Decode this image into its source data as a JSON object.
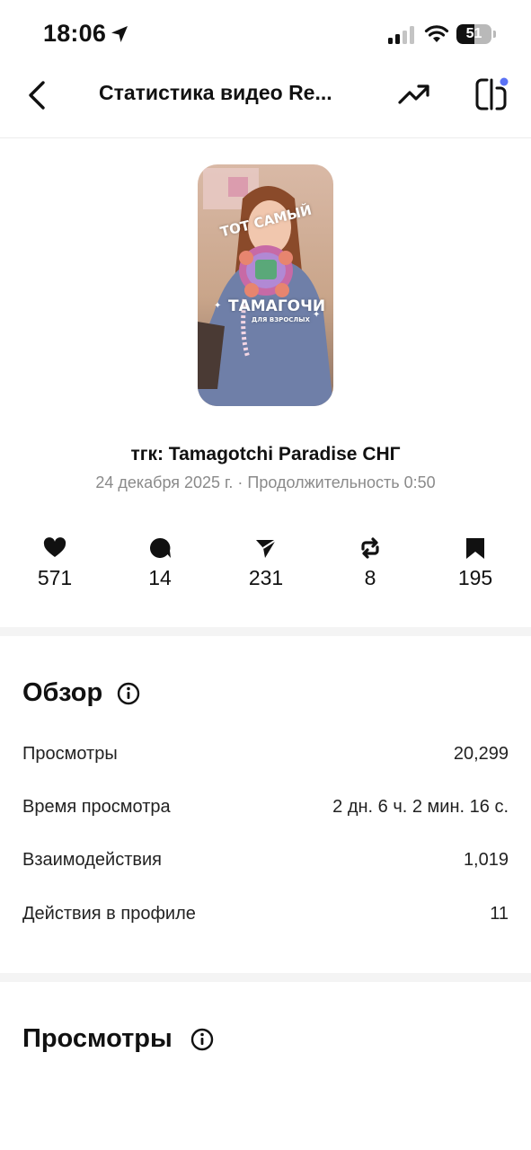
{
  "status_bar": {
    "time": "18:06",
    "battery_level": "51",
    "battery_fraction": 0.51
  },
  "nav": {
    "title": "Статистика видео Re...",
    "back_icon": "chevron-left-icon",
    "trend_icon": "trending-up-icon",
    "compare_icon": "compare-icon",
    "notification_dot_color": "#5b72f5"
  },
  "thumbnail": {
    "caption_top": "ТОТ САМЫЙ",
    "caption_main": "ТАМАГОЧИ",
    "caption_sub": "ДЛЯ ВЗРОСЛЫХ"
  },
  "video": {
    "title": "тгк: Tamagotchi Paradise СНГ",
    "meta": "24 декабря 2025 г. · Продолжительность 0:50"
  },
  "metrics": [
    {
      "icon": "heart-icon",
      "value": "571"
    },
    {
      "icon": "comment-icon",
      "value": "14"
    },
    {
      "icon": "send-icon",
      "value": "231"
    },
    {
      "icon": "repost-icon",
      "value": "8"
    },
    {
      "icon": "bookmark-icon",
      "value": "195"
    }
  ],
  "overview": {
    "heading": "Обзор",
    "rows": [
      {
        "label": "Просмотры",
        "value": "20,299"
      },
      {
        "label": "Время просмотра",
        "value": "2 дн. 6 ч. 2 мин. 16 с."
      },
      {
        "label": "Взаимодействия",
        "value": "1,019"
      },
      {
        "label": "Действия в профиле",
        "value": "11"
      }
    ]
  },
  "views_section": {
    "heading": "Просмотры"
  }
}
